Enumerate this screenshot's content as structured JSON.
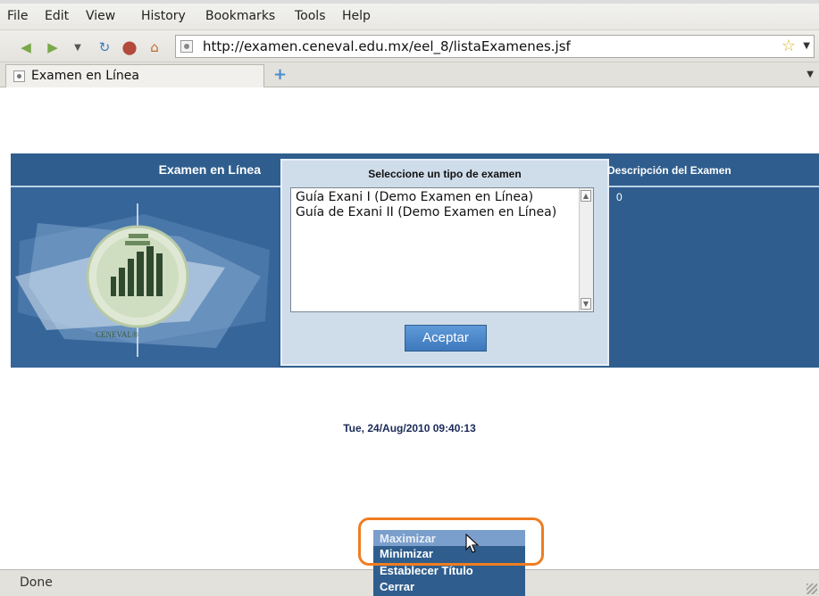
{
  "browser": {
    "menu": [
      "File",
      "Edit",
      "View",
      "History",
      "Bookmarks",
      "Tools",
      "Help"
    ],
    "url": "http://examen.ceneval.edu.mx/eel_8/listaExamenes.jsf",
    "tab_title": "Examen en Línea",
    "status": "Done"
  },
  "page": {
    "left_title": "Examen en Línea",
    "logo_text": "CENEVAL®",
    "center_title": "Seleccione un tipo de examen",
    "options": [
      "Guía Exani I (Demo Examen en Línea)",
      "Guía de Exani II (Demo Examen en Línea)"
    ],
    "accept_label": "Aceptar",
    "right_title": "Descripción del Examen",
    "right_value": "0",
    "datetime": "Tue, 24/Aug/2010 09:40:13"
  },
  "context_menu": {
    "items": [
      "Maximizar",
      "Minimizar",
      "Establecer Título",
      "Cerrar"
    ]
  },
  "colors": {
    "band": "#2f5e8e",
    "panel": "#cfdcea",
    "highlight": "#ef7d22"
  }
}
